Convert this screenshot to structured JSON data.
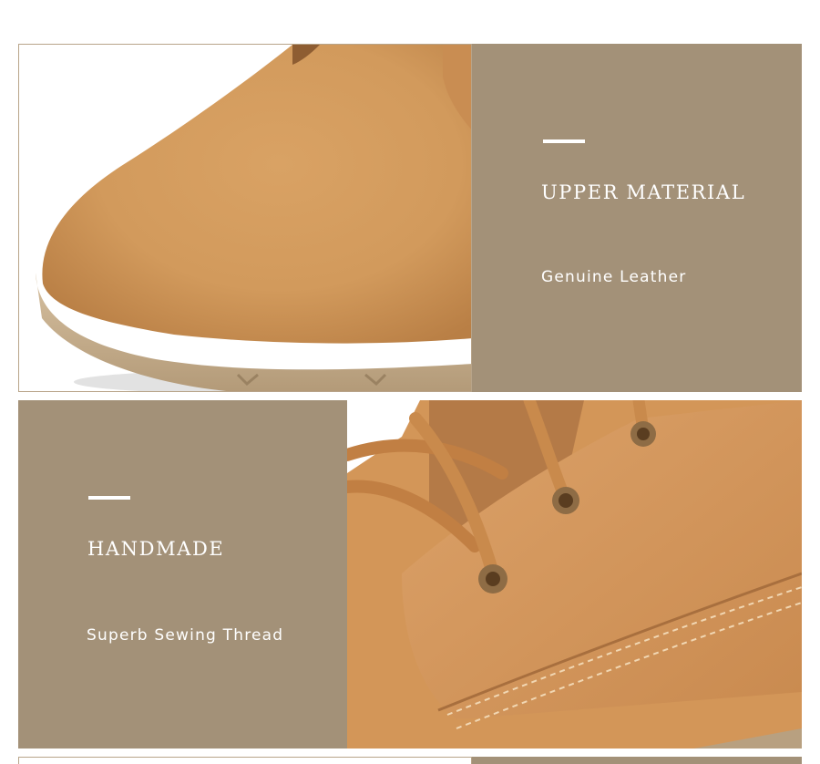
{
  "features": [
    {
      "title": "UPPER MATERIAL",
      "subtitle": "Genuine Leather"
    },
    {
      "title": "HANDMADE",
      "subtitle": "Superb Sewing Thread"
    }
  ],
  "colors": {
    "panel": "#a39178",
    "leather": "#d69a5c",
    "sole": "#c9b08e",
    "text": "#ffffff"
  }
}
